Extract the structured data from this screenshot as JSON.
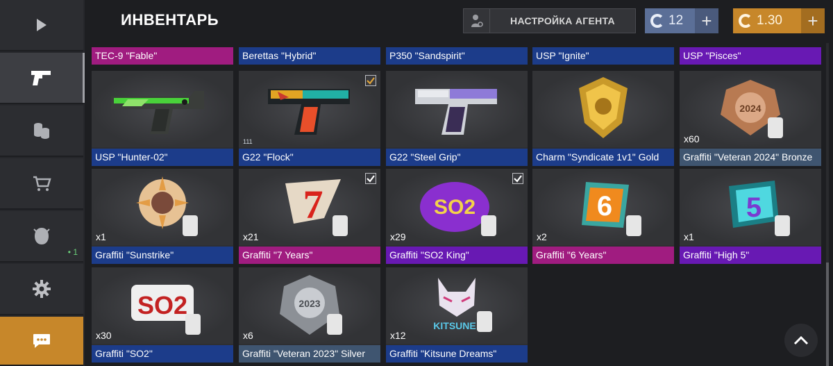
{
  "header": {
    "title": "ИНВЕНТАРЬ",
    "agent_button": "НАСТРОЙКА АГЕНТА",
    "silver": {
      "amount": "12",
      "plus": "+"
    },
    "gold": {
      "amount": "1.30",
      "plus": "+"
    }
  },
  "sidebar": {
    "items": [
      {
        "name": "play-icon"
      },
      {
        "name": "pistol-icon"
      },
      {
        "name": "coins-icon"
      },
      {
        "name": "cart-icon"
      },
      {
        "name": "agent-icon",
        "badge": "• 1"
      },
      {
        "name": "gear-icon"
      },
      {
        "name": "chat-icon"
      }
    ]
  },
  "top_row": [
    {
      "label": "TEC-9 \"Fable\"",
      "color": "#a01c80"
    },
    {
      "label": "Berettas \"Hybrid\"",
      "color": "#1c3c8a"
    },
    {
      "label": "P350 \"Sandspirit\"",
      "color": "#1c3c8a"
    },
    {
      "label": "USP \"Ignite\"",
      "color": "#1c3c8a"
    },
    {
      "label": "USP \"Pisces\"",
      "color": "#6819b3"
    }
  ],
  "items": [
    {
      "label": "USP \"Hunter-02\"",
      "qty": "",
      "checked": false
    },
    {
      "label": "G22 \"Flock\"",
      "qty": "",
      "checked": true,
      "tier": "111"
    },
    {
      "label": "G22 \"Steel Grip\"",
      "qty": "",
      "checked": false
    },
    {
      "label": "Charm \"Syndicate 1v1\" Gold",
      "qty": "",
      "checked": false
    },
    {
      "label": "Graffiti \"Veteran 2024\" Bronze",
      "qty": "x60",
      "checked": false
    },
    {
      "label": "Graffiti \"Sunstrike\"",
      "qty": "x1",
      "checked": false
    },
    {
      "label": "Graffiti \"7 Years\"",
      "qty": "x21",
      "checked": true
    },
    {
      "label": "Graffiti \"SO2 King\"",
      "qty": "x29",
      "checked": true
    },
    {
      "label": "Graffiti \"6 Years\"",
      "qty": "x2",
      "checked": false
    },
    {
      "label": "Graffiti \"High 5\"",
      "qty": "x1",
      "checked": false
    },
    {
      "label": "Graffiti \"SO2\"",
      "qty": "x30",
      "checked": false
    },
    {
      "label": "Graffiti \"Veteran 2023\" Silver",
      "qty": "x6",
      "checked": false
    },
    {
      "label": "Graffiti \"Kitsune Dreams\"",
      "qty": "x12",
      "checked": false
    }
  ],
  "art_text": {
    "veteran2024": "2024",
    "veteran2023": "2023",
    "so2king": "SO2",
    "so2": "SO2",
    "seven": "7",
    "six": "6",
    "high5": "5",
    "kitsune": "KITSUNE"
  },
  "colors": {
    "blue": "#1c3c8a",
    "pink": "#a01c80",
    "purple": "#6819b3",
    "steel": "#3f5570",
    "gold_accent": "#c7872a",
    "silver_accent": "#5b6f97"
  }
}
